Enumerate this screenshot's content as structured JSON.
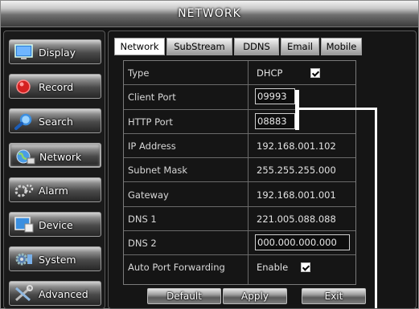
{
  "window": {
    "title": "NETWORK"
  },
  "sidebar": {
    "items": [
      {
        "label": "Display",
        "icon": "monitor-icon"
      },
      {
        "label": "Record",
        "icon": "record-icon"
      },
      {
        "label": "Search",
        "icon": "magnifier-icon"
      },
      {
        "label": "Network",
        "icon": "network-globe-icon",
        "active": true
      },
      {
        "label": "Alarm",
        "icon": "alarm-icon"
      },
      {
        "label": "Device",
        "icon": "device-icon"
      },
      {
        "label": "System",
        "icon": "system-gear-icon"
      },
      {
        "label": "Advanced",
        "icon": "advanced-tools-icon"
      }
    ]
  },
  "tabs": [
    {
      "label": "Network",
      "active": true
    },
    {
      "label": "SubStream"
    },
    {
      "label": "DDNS"
    },
    {
      "label": "Email"
    },
    {
      "label": "Mobile"
    }
  ],
  "settings": {
    "type": {
      "label": "Type",
      "value": "DHCP"
    },
    "client_port": {
      "label": "Client Port",
      "value": "09993"
    },
    "http_port": {
      "label": "HTTP Port",
      "value": "08883"
    },
    "ip_address": {
      "label": "IP Address",
      "value": "192.168.001.102"
    },
    "subnet_mask": {
      "label": "Subnet Mask",
      "value": "255.255.255.000"
    },
    "gateway": {
      "label": "Gateway",
      "value": "192.168.001.001"
    },
    "dns1": {
      "label": "DNS 1",
      "value": "221.005.088.088"
    },
    "dns2": {
      "label": "DNS 2",
      "value": "000.000.000.000"
    },
    "auto_port_forwarding": {
      "label": "Auto Port Forwarding",
      "value": "Enable"
    }
  },
  "buttons": {
    "default": "Default",
    "apply": "Apply",
    "exit": "Exit"
  },
  "colors": {
    "background": "#111111",
    "text": "#e2e2e2",
    "callout": "#ffffff"
  }
}
